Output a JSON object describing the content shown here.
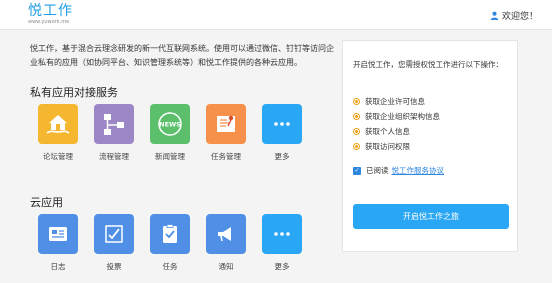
{
  "header": {
    "logo_text": "悦工作",
    "logo_url_text": "www.yuwork.me",
    "welcome": "欢迎您！"
  },
  "intro": {
    "text": "悦工作，基于混合云理念研发的新一代互联网系统。使用可以通过微信、钉钉等访问企业私有的应用（如协同平台、知识管理系统等）和悦工作提供的各种云应用。"
  },
  "private_apps": {
    "title": "私有应用对接服务",
    "items": [
      {
        "label": "论坛管理",
        "color": "#f5b730",
        "icon": "home-hand-icon"
      },
      {
        "label": "流程管理",
        "color": "#9b86c6",
        "icon": "flowchart-icon"
      },
      {
        "label": "新闻管理",
        "color": "#5cbf6c",
        "icon": "news-icon"
      },
      {
        "label": "任务管理",
        "color": "#f6904a",
        "icon": "pin-board-icon"
      },
      {
        "label": "更多",
        "color": "#2aa7f4",
        "icon": "more-icon"
      }
    ]
  },
  "cloud_apps": {
    "title": "云应用",
    "items": [
      {
        "label": "日志",
        "color": "#4f8fe6",
        "icon": "journal-icon"
      },
      {
        "label": "投票",
        "color": "#4f8fe6",
        "icon": "vote-icon"
      },
      {
        "label": "任务",
        "color": "#4f8fe6",
        "icon": "clipboard-check-icon"
      },
      {
        "label": "通知",
        "color": "#4f8fe6",
        "icon": "megaphone-icon"
      },
      {
        "label": "更多",
        "color": "#2aa7f4",
        "icon": "more-icon"
      }
    ]
  },
  "panel": {
    "intro": "开启悦工作，您需授权悦工作进行以下操作：",
    "permissions": [
      "获取企业许可信息",
      "获取企业组织架构信息",
      "获取个人信息",
      "获取访问权限"
    ],
    "agree_prefix": "已阅读",
    "agree_link": "悦工作服务协议",
    "start_button": "开启悦工作之旅"
  }
}
